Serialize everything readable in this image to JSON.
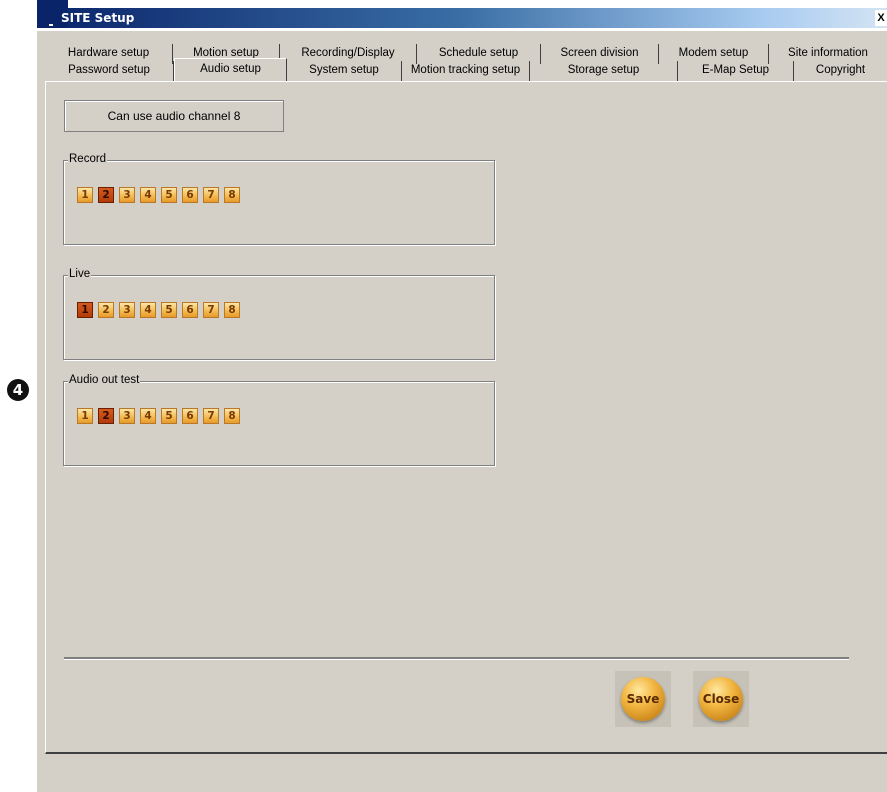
{
  "callout": {
    "label": "4"
  },
  "window": {
    "title": "SITE Setup",
    "close_label": "X"
  },
  "tabs": {
    "row1": [
      "Hardware setup",
      "Motion setup",
      "Recording/Display",
      "Schedule setup",
      "Screen division",
      "Modem setup",
      "Site information"
    ],
    "row2": [
      "Password setup",
      "Audio setup",
      "System setup",
      "Motion tracking setup",
      "Storage setup",
      "E-Map Setup",
      "Copyright"
    ],
    "active": "Audio setup"
  },
  "info": {
    "text": "Can use audio channel  8"
  },
  "groups": [
    {
      "label": "Record",
      "channels": [
        "1",
        "2",
        "3",
        "4",
        "5",
        "6",
        "7",
        "8"
      ],
      "selected": "2"
    },
    {
      "label": "Live",
      "channels": [
        "1",
        "2",
        "3",
        "4",
        "5",
        "6",
        "7",
        "8"
      ],
      "selected": "1"
    },
    {
      "label": "Audio out test",
      "channels": [
        "1",
        "2",
        "3",
        "4",
        "5",
        "6",
        "7",
        "8"
      ],
      "selected": "2"
    }
  ],
  "buttons": {
    "save": "Save",
    "close": "Close"
  },
  "colors": {
    "panel": "#d4d0c8",
    "titlebar_start": "#0a246a",
    "channel_on": "#c0440e",
    "channel_off": "#f2b94e"
  }
}
